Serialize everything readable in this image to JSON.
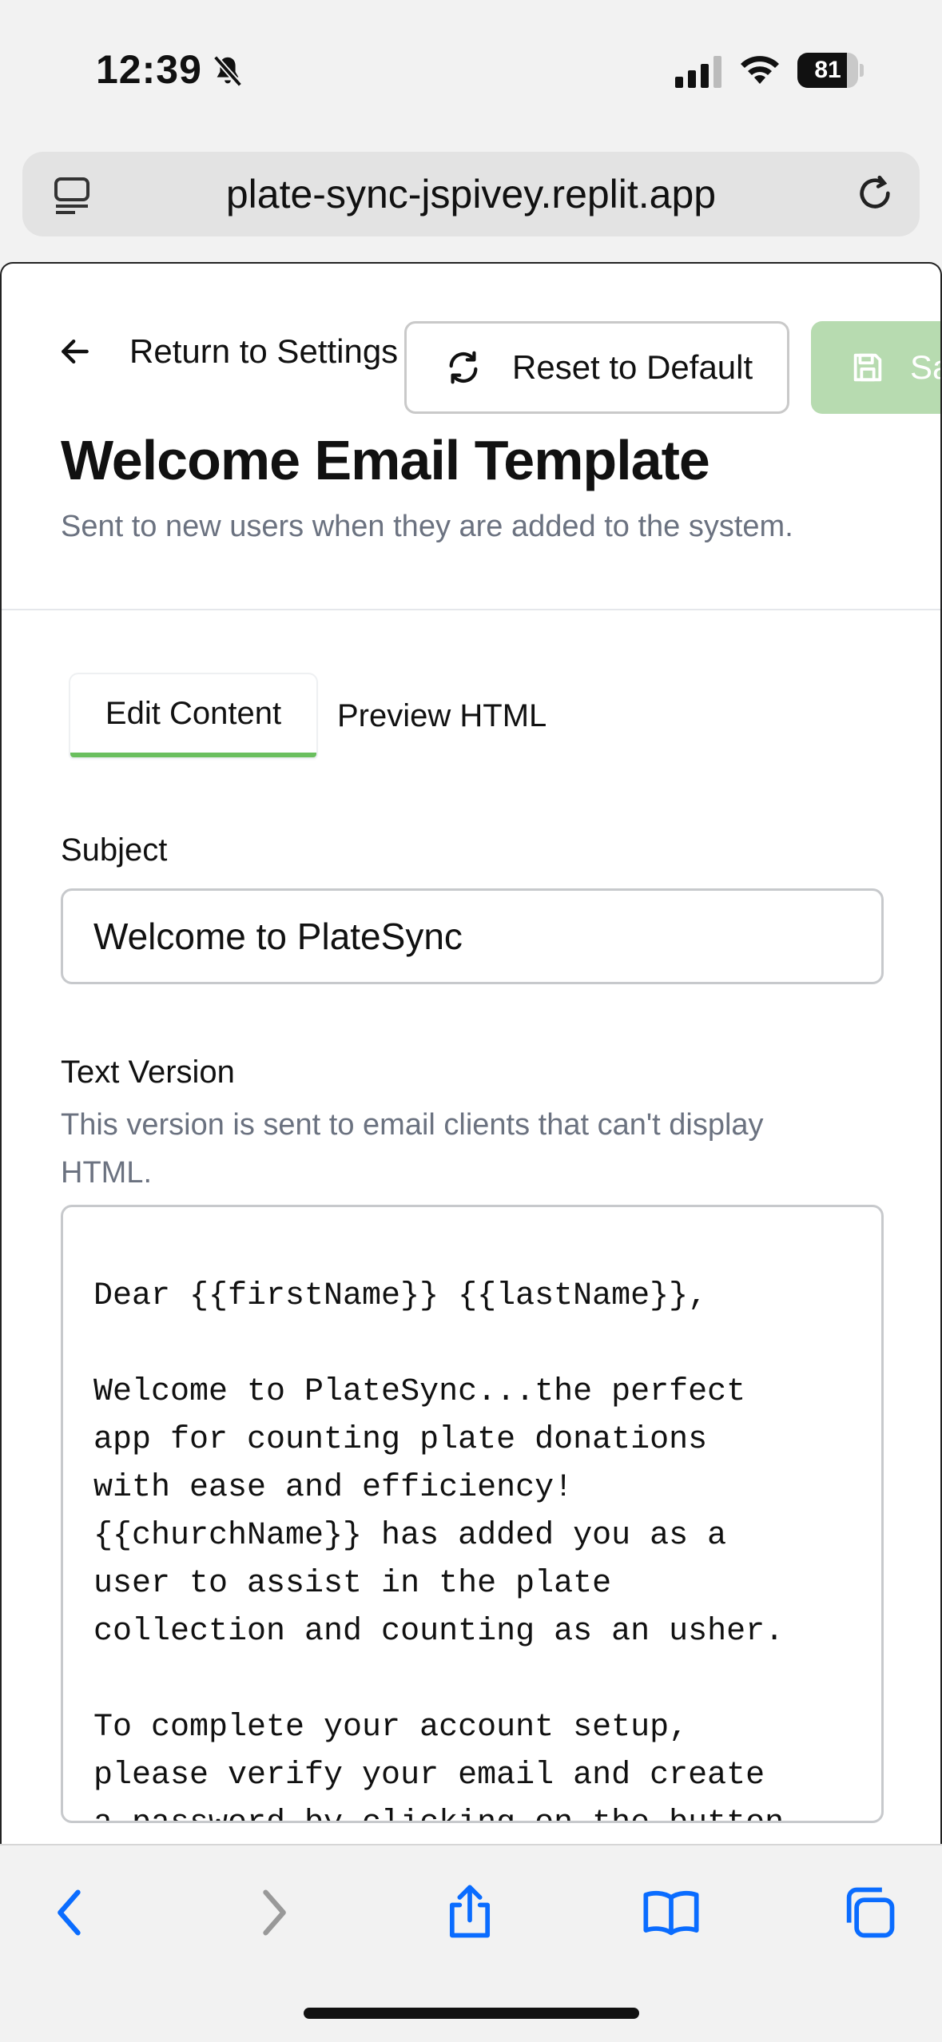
{
  "status_bar": {
    "time": "12:39",
    "battery": "81",
    "battery_level": 0.81,
    "icons": [
      "bell-slash-icon",
      "cellular-signal-icon",
      "wifi-icon",
      "battery-icon"
    ]
  },
  "browser": {
    "url": "plate-sync-jspivey.replit.app",
    "icons": [
      "tab-menu-icon",
      "reload-icon"
    ]
  },
  "header": {
    "back_label": "Return to Settings",
    "reset_label": "Reset to Default",
    "save_label": "Sa",
    "title": "Welcome Email Template",
    "subtitle": "Sent to new users when they are added to the system."
  },
  "tabs": [
    {
      "label": "Edit Content",
      "active": true
    },
    {
      "label": "Preview HTML",
      "active": false
    }
  ],
  "form": {
    "subject_label": "Subject",
    "subject_value": "Welcome to PlateSync",
    "text_version_label": "Text Version",
    "text_version_help": "This version is sent to email clients that can't display HTML.",
    "text_version_value": "Dear {{firstName}} {{lastName}},\n\nWelcome to PlateSync...the perfect\napp for counting plate donations\nwith ease and efficiency!\n{{churchName}} has added you as a\nuser to assist in the plate\ncollection and counting as an usher.\n\nTo complete your account setup,\nplease verify your email and create\na password by clicking on the button"
  },
  "toolbar": {
    "icons": [
      "back-icon",
      "forward-icon",
      "share-icon",
      "bookmarks-icon",
      "tabs-icon"
    ]
  },
  "colors": {
    "accent_green": "#6abf5e",
    "save_button_disabled": "#b7dbb0",
    "muted_text": "#6b7280",
    "ios_blue": "#0a6cff"
  }
}
